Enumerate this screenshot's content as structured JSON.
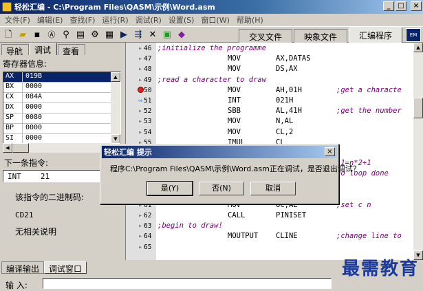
{
  "window": {
    "title": "轻松汇编 - C:\\Program Files\\QASM\\示例\\Word.asm"
  },
  "menu": [
    "文件(F)",
    "编辑(E)",
    "查找(F)",
    "运行(R)",
    "调试(R)",
    "设置(S)",
    "窗口(W)",
    "帮助(H)"
  ],
  "toolbar": {
    "icons": [
      "new-file-icon",
      "open-folder-icon",
      "save-icon",
      "find-icon",
      "binoculars-icon",
      "compile-icon",
      "settings-icon",
      "memory-icon",
      "run-icon",
      "step-icon",
      "tools-icon",
      "green-book-icon",
      "purple-book-icon"
    ],
    "tabs": [
      {
        "label": "交叉文件",
        "active": false
      },
      {
        "label": "映象文件",
        "active": false
      },
      {
        "label": "汇编程序",
        "active": true
      }
    ],
    "corner": "EM"
  },
  "left": {
    "tabs": [
      {
        "label": "导航",
        "active": false
      },
      {
        "label": "调试",
        "active": true
      },
      {
        "label": "查看",
        "active": false
      }
    ],
    "registers_title": "寄存器信息:",
    "registers": [
      {
        "name": "AX",
        "value": "019B",
        "selected": true
      },
      {
        "name": "BX",
        "value": "0000",
        "selected": false
      },
      {
        "name": "CX",
        "value": "084A",
        "selected": false
      },
      {
        "name": "DX",
        "value": "0000",
        "selected": false
      },
      {
        "name": "SP",
        "value": "0080",
        "selected": false
      },
      {
        "name": "BP",
        "value": "0000",
        "selected": false
      },
      {
        "name": "SI",
        "value": "0000",
        "selected": false
      }
    ],
    "next_title": "下一条指令:",
    "next_op": "INT",
    "next_arg": "21",
    "binary_label": "该指令的二进制码:",
    "binary_value": "CD21",
    "no_desc": "无相关说明"
  },
  "code_lines": [
    {
      "num": "46",
      "marker": "dot",
      "comment": ";initialize the programme",
      "op": "",
      "args": "",
      "tail": ""
    },
    {
      "num": "47",
      "marker": "dot",
      "comment": "",
      "op": "MOV",
      "args": "AX,DATAS",
      "tail": ""
    },
    {
      "num": "48",
      "marker": "dot",
      "comment": "",
      "op": "MOV",
      "args": "DS,AX",
      "tail": ""
    },
    {
      "num": "49",
      "marker": "dot",
      "comment": ";read a character to draw",
      "op": "",
      "args": "",
      "tail": ""
    },
    {
      "num": "50",
      "marker": "breakpoint",
      "comment": "",
      "op": "MOV",
      "args": "AH,01H",
      "tail": ";get a characte"
    },
    {
      "num": "51",
      "marker": "arrow",
      "comment": "",
      "op": "INT",
      "args": "021H",
      "tail": ""
    },
    {
      "num": "52",
      "marker": "dot",
      "comment": "",
      "op": "SBB",
      "args": "AL,41H",
      "tail": ";get the number"
    },
    {
      "num": "53",
      "marker": "dot",
      "comment": "",
      "op": "MOV",
      "args": "N,AL",
      "tail": ""
    },
    {
      "num": "54",
      "marker": "dot",
      "comment": "",
      "op": "MOV",
      "args": "CL,2",
      "tail": ""
    },
    {
      "num": "55",
      "marker": "dot",
      "comment": "",
      "op": "IMUL",
      "args": "CL",
      "tail": ""
    },
    {
      "num": "56",
      "marker": "dot",
      "comment": "",
      "op": "",
      "args": "",
      "tail": ""
    },
    {
      "num": "57",
      "marker": "dot",
      "comment": "",
      "op": "",
      "args": "",
      "tail": "l1=n*2+1"
    },
    {
      "num": "58",
      "marker": "dot",
      "comment": "",
      "op": "",
      "args": "",
      "tail": "no loop done"
    },
    {
      "num": "59",
      "marker": "dot",
      "comment": "",
      "op": "",
      "args": "",
      "tail": ""
    },
    {
      "num": "60",
      "marker": "dot",
      "comment": "",
      "op": "",
      "args": "",
      "tail": ""
    },
    {
      "num": "61",
      "marker": "dot",
      "comment": "",
      "op": "MOV",
      "args": "OC,AL",
      "tail": ";set c n"
    },
    {
      "num": "62",
      "marker": "dot",
      "comment": "",
      "op": "CALL",
      "args": "PINISET",
      "tail": ""
    },
    {
      "num": "63",
      "marker": "dot",
      "comment": ";begin to draw!",
      "op": "",
      "args": "",
      "tail": ""
    },
    {
      "num": "64",
      "marker": "dot",
      "comment": "",
      "op": "MOUTPUT",
      "args": "CLINE",
      "tail": ";change line to"
    },
    {
      "num": "65",
      "marker": "dot",
      "comment": "",
      "op": "",
      "args": "",
      "tail": ""
    }
  ],
  "bottom": {
    "tabs": [
      {
        "label": "编译输出",
        "active": false
      },
      {
        "label": "调试窗口",
        "active": true
      }
    ],
    "input_label": "输  入:",
    "watermark": "最需教育"
  },
  "dialog": {
    "title": "轻松汇编 提示",
    "message": "程序C:\\Program Files\\QASM\\示例\\Word.asm正在调试，是否退出调试？",
    "buttons": [
      {
        "label": "是(Y)",
        "default": true
      },
      {
        "label": "否(N)",
        "default": false
      },
      {
        "label": "取消",
        "default": false
      }
    ]
  }
}
